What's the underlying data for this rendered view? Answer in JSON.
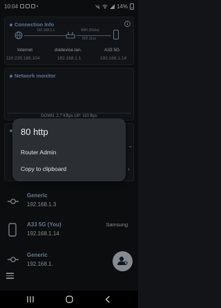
{
  "status_bar": {
    "time": "10:04",
    "battery": "14%"
  },
  "connection_info": {
    "title": "Connection Info",
    "internet": {
      "label": "Internet",
      "ip": "110.235.189.104"
    },
    "router": {
      "label": "dsldevice.lan.",
      "ip": "192.168.1.1",
      "link_ip": "192.168.1.1"
    },
    "device": {
      "label": "A33 5G",
      "ip": "192.168.1.14"
    },
    "wifi": {
      "band": "WiFi (5Ghz)",
      "standard": "802.11ac"
    }
  },
  "network_monitor": {
    "title": "Network monitor",
    "speed": "DOWN: 2.7 KBps  UP: 110 Bps"
  },
  "context_menu": {
    "title": "80 http",
    "items": [
      {
        "label": "Router Admin"
      },
      {
        "label": "Copy to clipboard"
      }
    ]
  },
  "devices": [
    {
      "name": "Generic",
      "ip": "192.168.1.3",
      "vendor": "",
      "icon": "router-icon"
    },
    {
      "name": "A33 5G (You)",
      "ip": "192.168.1.14",
      "vendor": "Samsung",
      "icon": "phone-icon"
    },
    {
      "name": "Generic",
      "ip": "192.168.1.",
      "vendor": "",
      "icon": "router-icon"
    }
  ],
  "icons": {
    "fab": "person-scan-icon",
    "menu": "hamburger-menu-icon"
  },
  "colors": {
    "accent": "#8fb0e6",
    "background": "#121417",
    "card": "#1b1e23",
    "popup": "#2b2e33"
  }
}
